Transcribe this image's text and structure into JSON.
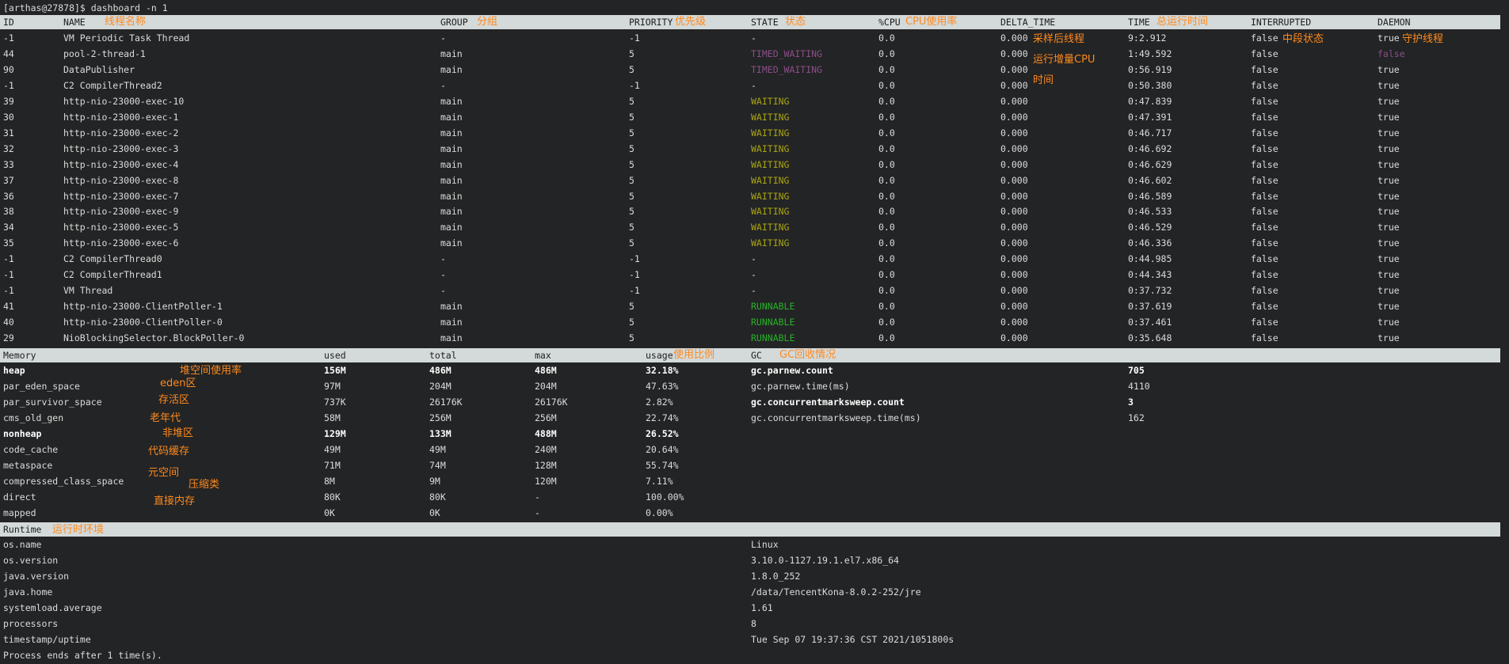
{
  "prompt": "[arthas@27878]$ dashboard -n 1",
  "thread_headers": {
    "id": "ID",
    "name": "NAME",
    "group": "GROUP",
    "priority": "PRIORITY",
    "state": "STATE",
    "cpu": "%CPU",
    "delta_time": "DELTA_TIME",
    "time": "TIME",
    "interrupted": "INTERRUPTED",
    "daemon": "DAEMON"
  },
  "threads": [
    {
      "id": "-1",
      "name": "VM Periodic Task Thread",
      "group": "-",
      "priority": "-1",
      "state": "-",
      "cpu": "0.0",
      "delta": "0.000",
      "time": "9:2.912",
      "interrupted": "false",
      "daemon": "true"
    },
    {
      "id": "44",
      "name": "pool-2-thread-1",
      "group": "main",
      "priority": "5",
      "state": "TIMED_WAITING",
      "cpu": "0.0",
      "delta": "0.000",
      "time": "1:49.592",
      "interrupted": "false",
      "daemon": "false"
    },
    {
      "id": "90",
      "name": "DataPublisher",
      "group": "main",
      "priority": "5",
      "state": "TIMED_WAITING",
      "cpu": "0.0",
      "delta": "0.000",
      "time": "0:56.919",
      "interrupted": "false",
      "daemon": "true"
    },
    {
      "id": "-1",
      "name": "C2 CompilerThread2",
      "group": "-",
      "priority": "-1",
      "state": "-",
      "cpu": "0.0",
      "delta": "0.000",
      "time": "0:50.380",
      "interrupted": "false",
      "daemon": "true"
    },
    {
      "id": "39",
      "name": "http-nio-23000-exec-10",
      "group": "main",
      "priority": "5",
      "state": "WAITING",
      "cpu": "0.0",
      "delta": "0.000",
      "time": "0:47.839",
      "interrupted": "false",
      "daemon": "true"
    },
    {
      "id": "30",
      "name": "http-nio-23000-exec-1",
      "group": "main",
      "priority": "5",
      "state": "WAITING",
      "cpu": "0.0",
      "delta": "0.000",
      "time": "0:47.391",
      "interrupted": "false",
      "daemon": "true"
    },
    {
      "id": "31",
      "name": "http-nio-23000-exec-2",
      "group": "main",
      "priority": "5",
      "state": "WAITING",
      "cpu": "0.0",
      "delta": "0.000",
      "time": "0:46.717",
      "interrupted": "false",
      "daemon": "true"
    },
    {
      "id": "32",
      "name": "http-nio-23000-exec-3",
      "group": "main",
      "priority": "5",
      "state": "WAITING",
      "cpu": "0.0",
      "delta": "0.000",
      "time": "0:46.692",
      "interrupted": "false",
      "daemon": "true"
    },
    {
      "id": "33",
      "name": "http-nio-23000-exec-4",
      "group": "main",
      "priority": "5",
      "state": "WAITING",
      "cpu": "0.0",
      "delta": "0.000",
      "time": "0:46.629",
      "interrupted": "false",
      "daemon": "true"
    },
    {
      "id": "37",
      "name": "http-nio-23000-exec-8",
      "group": "main",
      "priority": "5",
      "state": "WAITING",
      "cpu": "0.0",
      "delta": "0.000",
      "time": "0:46.602",
      "interrupted": "false",
      "daemon": "true"
    },
    {
      "id": "36",
      "name": "http-nio-23000-exec-7",
      "group": "main",
      "priority": "5",
      "state": "WAITING",
      "cpu": "0.0",
      "delta": "0.000",
      "time": "0:46.589",
      "interrupted": "false",
      "daemon": "true"
    },
    {
      "id": "38",
      "name": "http-nio-23000-exec-9",
      "group": "main",
      "priority": "5",
      "state": "WAITING",
      "cpu": "0.0",
      "delta": "0.000",
      "time": "0:46.533",
      "interrupted": "false",
      "daemon": "true"
    },
    {
      "id": "34",
      "name": "http-nio-23000-exec-5",
      "group": "main",
      "priority": "5",
      "state": "WAITING",
      "cpu": "0.0",
      "delta": "0.000",
      "time": "0:46.529",
      "interrupted": "false",
      "daemon": "true"
    },
    {
      "id": "35",
      "name": "http-nio-23000-exec-6",
      "group": "main",
      "priority": "5",
      "state": "WAITING",
      "cpu": "0.0",
      "delta": "0.000",
      "time": "0:46.336",
      "interrupted": "false",
      "daemon": "true"
    },
    {
      "id": "-1",
      "name": "C2 CompilerThread0",
      "group": "-",
      "priority": "-1",
      "state": "-",
      "cpu": "0.0",
      "delta": "0.000",
      "time": "0:44.985",
      "interrupted": "false",
      "daemon": "true"
    },
    {
      "id": "-1",
      "name": "C2 CompilerThread1",
      "group": "-",
      "priority": "-1",
      "state": "-",
      "cpu": "0.0",
      "delta": "0.000",
      "time": "0:44.343",
      "interrupted": "false",
      "daemon": "true"
    },
    {
      "id": "-1",
      "name": "VM Thread",
      "group": "-",
      "priority": "-1",
      "state": "-",
      "cpu": "0.0",
      "delta": "0.000",
      "time": "0:37.732",
      "interrupted": "false",
      "daemon": "true"
    },
    {
      "id": "41",
      "name": "http-nio-23000-ClientPoller-1",
      "group": "main",
      "priority": "5",
      "state": "RUNNABLE",
      "cpu": "0.0",
      "delta": "0.000",
      "time": "0:37.619",
      "interrupted": "false",
      "daemon": "true"
    },
    {
      "id": "40",
      "name": "http-nio-23000-ClientPoller-0",
      "group": "main",
      "priority": "5",
      "state": "RUNNABLE",
      "cpu": "0.0",
      "delta": "0.000",
      "time": "0:37.461",
      "interrupted": "false",
      "daemon": "true"
    },
    {
      "id": "29",
      "name": "NioBlockingSelector.BlockPoller-0",
      "group": "main",
      "priority": "5",
      "state": "RUNNABLE",
      "cpu": "0.0",
      "delta": "0.000",
      "time": "0:35.648",
      "interrupted": "false",
      "daemon": "true"
    }
  ],
  "memory_headers": {
    "memory": "Memory",
    "used": "used",
    "total": "total",
    "max": "max",
    "usage": "usage",
    "gc": "GC"
  },
  "memory": [
    {
      "name": "heap",
      "used": "156M",
      "total": "486M",
      "max": "486M",
      "usage": "32.18%",
      "bold": true
    },
    {
      "name": "par_eden_space",
      "used": "97M",
      "total": "204M",
      "max": "204M",
      "usage": "47.63%",
      "bold": false
    },
    {
      "name": "par_survivor_space",
      "used": "737K",
      "total": "26176K",
      "max": "26176K",
      "usage": "2.82%",
      "bold": false
    },
    {
      "name": "cms_old_gen",
      "used": "58M",
      "total": "256M",
      "max": "256M",
      "usage": "22.74%",
      "bold": false
    },
    {
      "name": "nonheap",
      "used": "129M",
      "total": "133M",
      "max": "488M",
      "usage": "26.52%",
      "bold": true
    },
    {
      "name": "code_cache",
      "used": "49M",
      "total": "49M",
      "max": "240M",
      "usage": "20.64%",
      "bold": false
    },
    {
      "name": "metaspace",
      "used": "71M",
      "total": "74M",
      "max": "128M",
      "usage": "55.74%",
      "bold": false
    },
    {
      "name": "compressed_class_space",
      "used": "8M",
      "total": "9M",
      "max": "120M",
      "usage": "7.11%",
      "bold": false
    },
    {
      "name": "direct",
      "used": "80K",
      "total": "80K",
      "max": "-",
      "usage": "100.00%",
      "bold": false
    },
    {
      "name": "mapped",
      "used": "0K",
      "total": "0K",
      "max": "-",
      "usage": "0.00%",
      "bold": false
    }
  ],
  "gc": [
    {
      "name": "gc.parnew.count",
      "value": "705",
      "bold": true
    },
    {
      "name": "gc.parnew.time(ms)",
      "value": "4110",
      "bold": false
    },
    {
      "name": "gc.concurrentmarksweep.count",
      "value": "3",
      "bold": true
    },
    {
      "name": "gc.concurrentmarksweep.time(ms)",
      "value": "162",
      "bold": false
    }
  ],
  "runtime_header": "Runtime",
  "runtime": [
    {
      "name": "os.name",
      "value": "Linux"
    },
    {
      "name": "os.version",
      "value": "3.10.0-1127.19.1.el7.x86_64"
    },
    {
      "name": "java.version",
      "value": "1.8.0_252"
    },
    {
      "name": "java.home",
      "value": "/data/TencentKona-8.0.2-252/jre"
    },
    {
      "name": "systemload.average",
      "value": "1.61"
    },
    {
      "name": "processors",
      "value": "8"
    },
    {
      "name": "timestamp/uptime",
      "value": "Tue Sep 07 19:37:36 CST 2021/1051800s"
    }
  ],
  "footer": "Process ends after 1 time(s).",
  "annotations": {
    "name": "线程名称",
    "group": "分组",
    "priority": "优先级",
    "state": "状态",
    "cpu": "CPU使用率",
    "time": "总运行时间",
    "delta_1": "采样后线程",
    "delta_2": "运行增量CPU",
    "delta_3": "时间",
    "interrupted": "中段状态",
    "daemon": "守护线程",
    "heap": "堆空间使用率",
    "eden": "eden区",
    "survivor": "存活区",
    "old": "老年代",
    "nonheap": "非堆区",
    "code_cache": "代码缓存",
    "metaspace": "元空间",
    "compressed": "压缩类",
    "direct": "直接内存",
    "usage": "使用比例",
    "gc": "GC回收情况",
    "runtime": "运行时环境"
  },
  "colors": {
    "annotation": "#ff8a1e",
    "timed_waiting": "#8a4f8a",
    "waiting": "#a8a414",
    "runnable": "#27b227",
    "header_bg": "#d4d9d9",
    "bg": "#232425"
  }
}
